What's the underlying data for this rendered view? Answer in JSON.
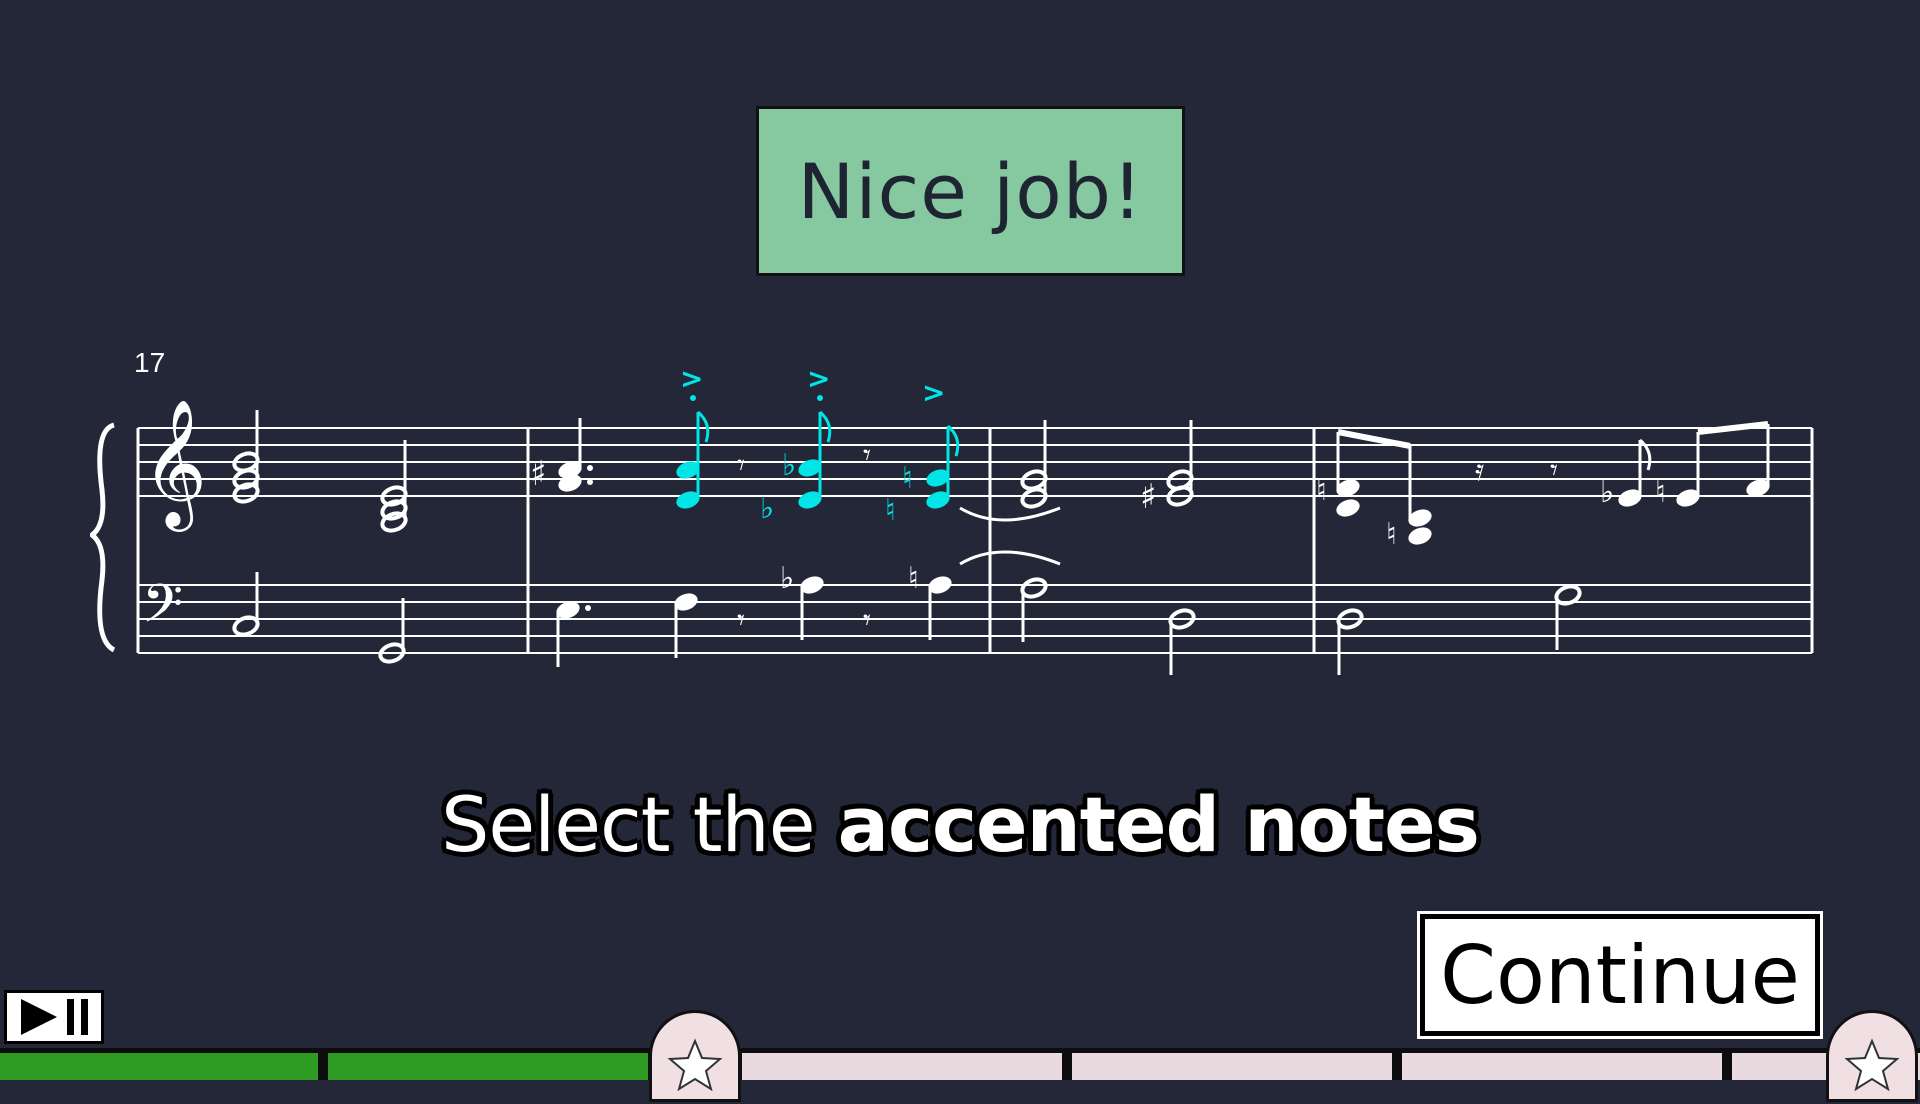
{
  "feedback": {
    "text": "Nice job!",
    "color": "#86c9a0"
  },
  "score": {
    "measure_number": "17",
    "note_color": "#ffffff",
    "highlight_color": "#00e5e5"
  },
  "prompt": {
    "prefix": "Select the",
    "emphasis": "accented notes"
  },
  "continue_label": "Continue",
  "player": {
    "icon": "play-pause-icon"
  },
  "progress": {
    "completed_color": "#2e9b22",
    "remaining_color": "#e8dade",
    "segments": [
      "completed",
      "completed",
      "remaining",
      "remaining",
      "remaining",
      "remaining"
    ],
    "milestones": [
      "star-icon",
      "star-icon"
    ]
  }
}
